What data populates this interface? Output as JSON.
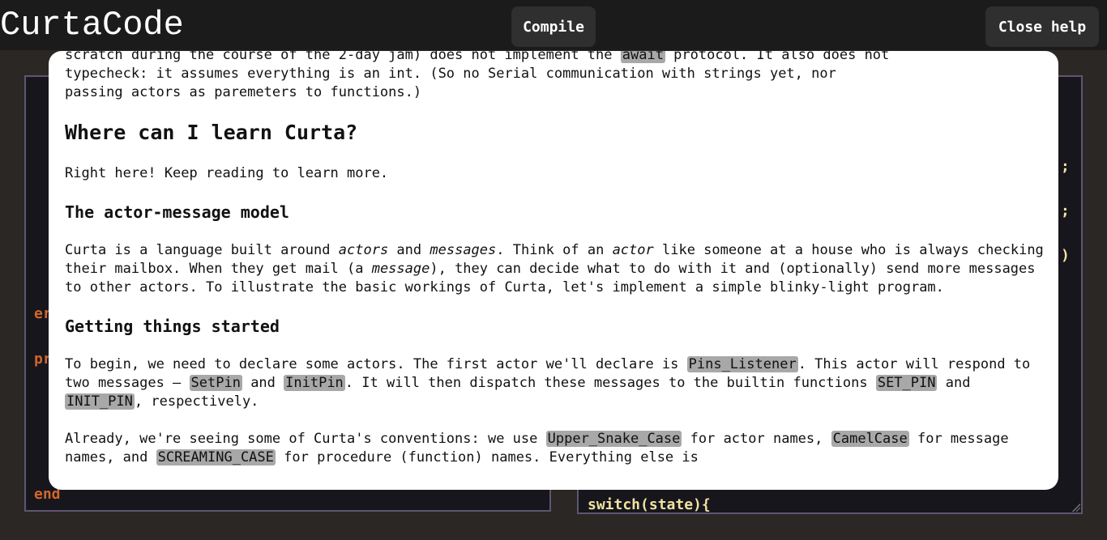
{
  "app": {
    "title": "CurtaCode",
    "compile_label": "Compile",
    "close_help_label": "Close help"
  },
  "editor_left": {
    "visible_fragments": [
      "er",
      "pr",
      "end"
    ]
  },
  "editor_right": {
    "visible_fragments": [
      ";",
      ";",
      ")",
      "switch(state){"
    ]
  },
  "help": {
    "intro_line1_a": "scratch during the course of the 2-day jam) does not implement the ",
    "intro_code": "await",
    "intro_line1_b": " protocol. It also does not",
    "intro_line2": "typecheck: it assumes everything is an int. (So no Serial communication with strings yet, nor",
    "intro_line3": "passing actors as paremeters to functions.)",
    "h_learn": "Where can I learn Curta?",
    "p_learn": "Right here! Keep reading to learn more.",
    "h_model": "The actor-message model",
    "p_model_1": "Curta is a language built around ",
    "p_model_em1": "actors",
    "p_model_2": " and ",
    "p_model_em2": "messages",
    "p_model_3": ". Think of an ",
    "p_model_em3": "actor",
    "p_model_4": " like someone at a house who is always checking their mailbox. When they get mail (a ",
    "p_model_em4": "message",
    "p_model_5": "), they can decide what to do with it and (optionally) send more messages to other actors. To illustrate the basic workings of Curta, let's implement a simple blinky-light program.",
    "h_start": "Getting things started",
    "p_start_1": "To begin, we need to declare some actors. The first actor we'll declare is ",
    "p_start_c1": "Pins_Listener",
    "p_start_2": ". This actor will respond to two messages — ",
    "p_start_c2": "SetPin",
    "p_start_3": " and ",
    "p_start_c3": "InitPin",
    "p_start_4": ". It will then dispatch these messages to the builtin functions ",
    "p_start_c4": "SET_PIN",
    "p_start_5": " and ",
    "p_start_c5": "INIT_PIN",
    "p_start_6": ", respectively.",
    "p_conv_1": "Already, we're seeing some of Curta's conventions: we use ",
    "p_conv_c1": "Upper_Snake_Case",
    "p_conv_2": " for actor names, ",
    "p_conv_c2": "CamelCase",
    "p_conv_3": " for message names, and ",
    "p_conv_c3": "SCREAMING_CASE",
    "p_conv_4": " for procedure (function) names. Everything else is"
  }
}
